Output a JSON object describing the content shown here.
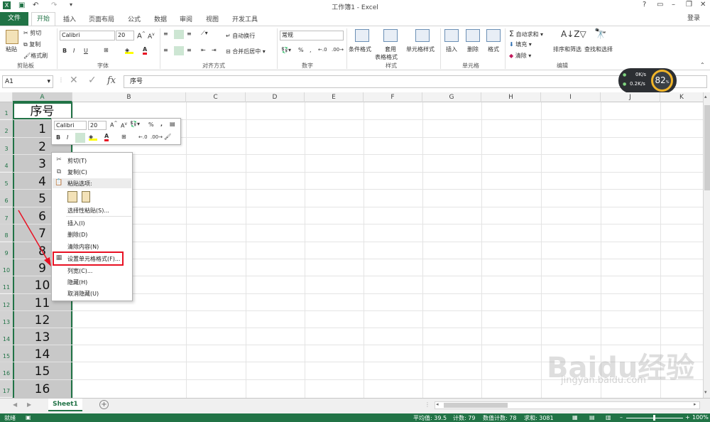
{
  "window": {
    "title": "工作簿1 - Excel",
    "help": "?",
    "user": "登录"
  },
  "tabs": [
    "文件",
    "开始",
    "插入",
    "页面布局",
    "公式",
    "数据",
    "审阅",
    "视图",
    "开发工具"
  ],
  "ribbon": {
    "clipboard": {
      "paste": "粘贴",
      "cut": "剪切",
      "copy": "复制",
      "format_painter": "格式刷",
      "label": "剪贴板"
    },
    "font": {
      "name": "Calibri",
      "size": "20",
      "bold": "B",
      "italic": "I",
      "underline": "U",
      "label": "字体"
    },
    "alignment": {
      "wrap": "自动换行",
      "merge": "合并后居中",
      "label": "对齐方式"
    },
    "number": {
      "format": "常规",
      "label": "数字"
    },
    "styles": {
      "conditional": "条件格式",
      "table1": "套用",
      "table2": "表格格式",
      "cellstyle": "单元格样式",
      "label": "样式"
    },
    "cells": {
      "insert": "插入",
      "delete": "删除",
      "format": "格式",
      "label": "单元格"
    },
    "editing": {
      "autosum": "自动求和",
      "fill": "填充",
      "clear": "清除",
      "sort": "排序和筛选",
      "find": "查找和选择",
      "label": "编辑"
    }
  },
  "namebox": "A1",
  "formula": "序号",
  "fx": "fx",
  "columns": [
    "A",
    "B",
    "C",
    "D",
    "E",
    "F",
    "G",
    "H",
    "I",
    "J",
    "K"
  ],
  "rows": [
    "1",
    "2",
    "3",
    "4",
    "5",
    "6",
    "7",
    "8",
    "9",
    "10",
    "11",
    "12",
    "13",
    "14",
    "15",
    "16",
    "17"
  ],
  "cells_a": [
    "序号",
    "1",
    "2",
    "3",
    "4",
    "5",
    "6",
    "7",
    "8",
    "9",
    "10",
    "11",
    "12",
    "13",
    "14",
    "15",
    "16"
  ],
  "mini_toolbar": {
    "font": "Calibri",
    "size": "20",
    "percent": "%",
    "comma": ",",
    "bold": "B",
    "italic": "I"
  },
  "context_menu": {
    "cut": "剪切(T)",
    "copy": "复制(C)",
    "paste_options": "粘贴选项:",
    "paste_special": "选择性粘贴(S)...",
    "insert": "插入(I)",
    "delete": "删除(D)",
    "clear": "清除内容(N)",
    "format_cells": "设置单元格格式(F)...",
    "col_width": "列宽(C)...",
    "hide": "隐藏(H)",
    "unhide": "取消隐藏(U)"
  },
  "sheet_tab": "Sheet1",
  "status": {
    "ready": "就绪",
    "average": "平均值: 39.5",
    "count": "计数: 79",
    "numcount": "数值计数: 78",
    "sum": "求和: 3081",
    "zoom": "100%"
  },
  "speed": {
    "up": "0K/s",
    "down": "0.2K/s",
    "percent": "82"
  },
  "watermark": "Baidu经验",
  "watermark_url": "jingyan.baidu.com",
  "colors": {
    "excel_green": "#217346",
    "highlight": "#e81123",
    "selected": "#c8c8c8"
  }
}
